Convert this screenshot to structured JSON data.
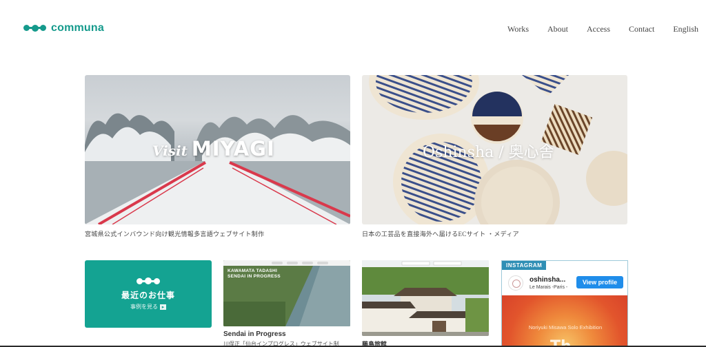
{
  "brand": {
    "name": "communa",
    "color": "#159a8c"
  },
  "nav": {
    "items": [
      "Works",
      "About",
      "Access",
      "Contact",
      "English"
    ]
  },
  "featured": [
    {
      "title_script": "Visit",
      "title_main": "MIYAGI",
      "caption": "宮城県公式インバウンド向け観光情報多言語ウェブサイト制作"
    },
    {
      "title": "Oshinsha / 奥心舎",
      "caption": "日本の工芸品を直接海外へ届けるECサイト ・メディア"
    }
  ],
  "recent_works": {
    "title": "最近のお仕事",
    "link": "事例を見る",
    "bg_color": "#14a392"
  },
  "sendai": {
    "image_text_line1": "KAWAMATA TADASHI",
    "image_text_line2": "SENDAI IN PROGRESS",
    "title": "Sendai in Progress",
    "subtitle": "川俣正「仙台インプログレス」ウェブサイト制"
  },
  "fujishima": {
    "title": "藤島旅館"
  },
  "instagram": {
    "badge": "INSTAGRAM",
    "account": "oshinsha...",
    "location": "Le Marais -Paris -",
    "button": "View profile",
    "post_caption": "Noriyuki Misawa Solo Exhibition",
    "post_big": "Th"
  }
}
